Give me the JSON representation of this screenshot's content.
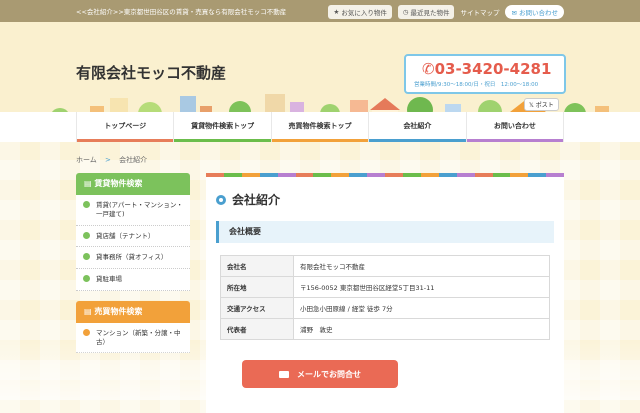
{
  "topbar": {
    "breadcrumb_text": "<<会社紹介>>東京都世田谷区の賃貸・売買なら有限会社モッコ不動産",
    "favorites": "お気に入り物件",
    "recent": "最近見た物件",
    "sitemap": "サイトマップ",
    "contact": "お問い合わせ"
  },
  "header": {
    "company": "有限会社モッコ不動産",
    "tel": "03-3420-4281",
    "hours": "営業時間/9:30〜18:00/日・祝日　12:00〜18:00",
    "post": "ポスト"
  },
  "nav": {
    "items": [
      "トップページ",
      "賃貸物件検索トップ",
      "売買物件検索トップ",
      "会社紹介",
      "お問い合わせ"
    ],
    "colors": [
      "#e77d5a",
      "#6bbd4b",
      "#f2a13a",
      "#4a9fcf",
      "#b77fd0"
    ]
  },
  "breadcrumb": {
    "home": "ホーム",
    "sep": ">",
    "current": "会社紹介"
  },
  "sidebar": {
    "rent": {
      "title": "賃貸物件検索",
      "color": "#7cc25c",
      "items": [
        "賃貸(アパート・マンション・一戸建て)",
        "貸店舗（テナント）",
        "貸事務所（貸オフィス）",
        "貸駐車場"
      ]
    },
    "sale": {
      "title": "売買物件検索",
      "color": "#f2a13a",
      "items": [
        "マンション（新築・分譲・中古）"
      ]
    }
  },
  "main": {
    "title": "会社紹介",
    "subtitle": "会社概要",
    "rows": [
      {
        "k": "会社名",
        "v": "有限会社モッコ不動産"
      },
      {
        "k": "所在地",
        "v": "〒156-0052 東京都世田谷区経堂5丁目31-11"
      },
      {
        "k": "交通アクセス",
        "v": "小田急小田原線 / 経堂 徒歩 7分"
      },
      {
        "k": "代表者",
        "v": "浦野　敦史"
      }
    ]
  },
  "mail_button": "メールでお問合せ"
}
